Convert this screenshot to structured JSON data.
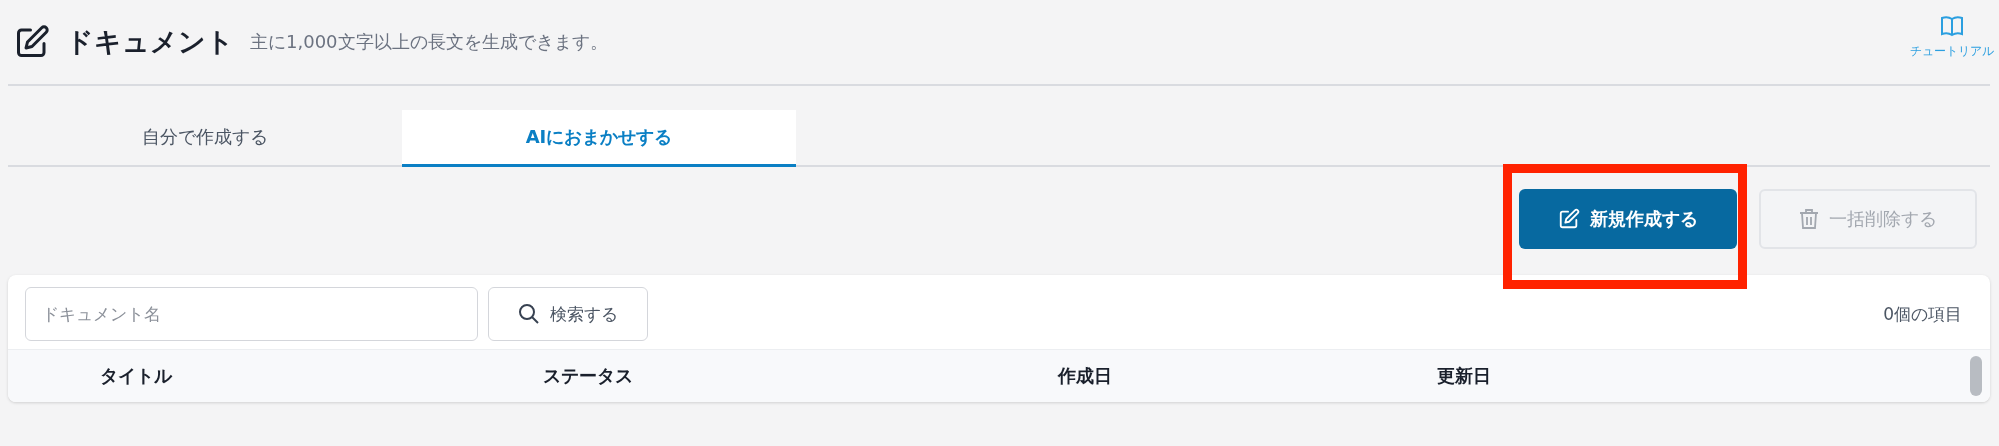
{
  "header": {
    "title": "ドキュメント",
    "subtitle": "主に1,000文字以上の長文を生成できます。",
    "tutorial_label": "チュートリアル"
  },
  "tabs": [
    {
      "label": "自分で作成する",
      "selected": false
    },
    {
      "label": "AIにおまかせする",
      "selected": true
    }
  ],
  "actions": [
    {
      "label": "新規作成する",
      "kind": "primary",
      "disabled": false,
      "highlighted": true
    },
    {
      "label": "一括削除する",
      "kind": "delete",
      "disabled": true,
      "highlighted": false
    }
  ],
  "search": {
    "placeholder": "ドキュメント名",
    "button": "検索する"
  },
  "item_count": "0個の項目",
  "table": {
    "columns": [
      "タイトル",
      "ステータス",
      "作成日",
      "更新日"
    ]
  }
}
